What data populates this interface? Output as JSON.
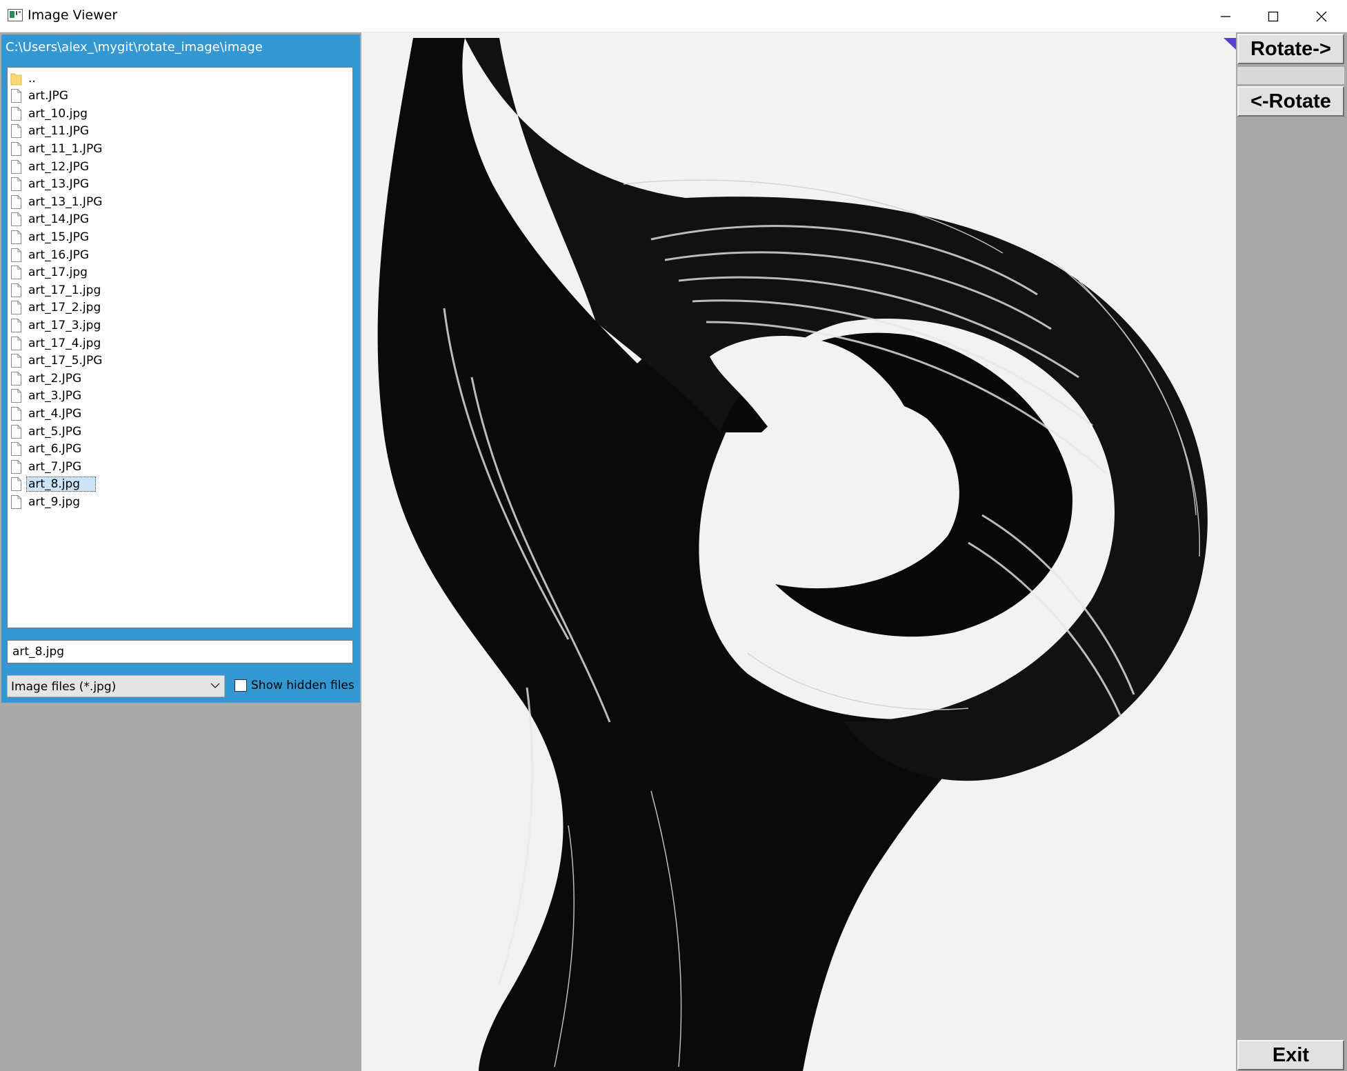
{
  "window": {
    "title": "Image Viewer"
  },
  "browser": {
    "path": "C:\\Users\\alex_\\mygit\\rotate_image\\image",
    "files": [
      {
        "name": "..",
        "type": "folder"
      },
      {
        "name": "art.JPG",
        "type": "file"
      },
      {
        "name": "art_10.jpg",
        "type": "file"
      },
      {
        "name": "art_11.JPG",
        "type": "file"
      },
      {
        "name": "art_11_1.JPG",
        "type": "file"
      },
      {
        "name": "art_12.JPG",
        "type": "file"
      },
      {
        "name": "art_13.JPG",
        "type": "file"
      },
      {
        "name": "art_13_1.JPG",
        "type": "file"
      },
      {
        "name": "art_14.JPG",
        "type": "file"
      },
      {
        "name": "art_15.JPG",
        "type": "file"
      },
      {
        "name": "art_16.JPG",
        "type": "file"
      },
      {
        "name": "art_17.jpg",
        "type": "file"
      },
      {
        "name": "art_17_1.jpg",
        "type": "file"
      },
      {
        "name": "art_17_2.jpg",
        "type": "file"
      },
      {
        "name": "art_17_3.jpg",
        "type": "file"
      },
      {
        "name": "art_17_4.jpg",
        "type": "file"
      },
      {
        "name": "art_17_5.JPG",
        "type": "file"
      },
      {
        "name": "art_2.JPG",
        "type": "file"
      },
      {
        "name": "art_3.JPG",
        "type": "file"
      },
      {
        "name": "art_4.JPG",
        "type": "file"
      },
      {
        "name": "art_5.JPG",
        "type": "file"
      },
      {
        "name": "art_6.JPG",
        "type": "file"
      },
      {
        "name": "art_7.JPG",
        "type": "file"
      },
      {
        "name": "art_8.jpg",
        "type": "file",
        "selected": true
      },
      {
        "name": "art_9.jpg",
        "type": "file"
      }
    ],
    "filename_value": "art_8.jpg",
    "filter_selected": "Image files (*.jpg)",
    "show_hidden_label": "Show hidden files",
    "show_hidden_checked": false
  },
  "toolbar": {
    "rotate_right_label": "Rotate->",
    "rotate_left_label": "<-Rotate",
    "exit_label": "Exit"
  },
  "colors": {
    "panel_blue": "#3397d2",
    "panel_gray": "#a9a9a9",
    "selection": "#cce4f7"
  }
}
